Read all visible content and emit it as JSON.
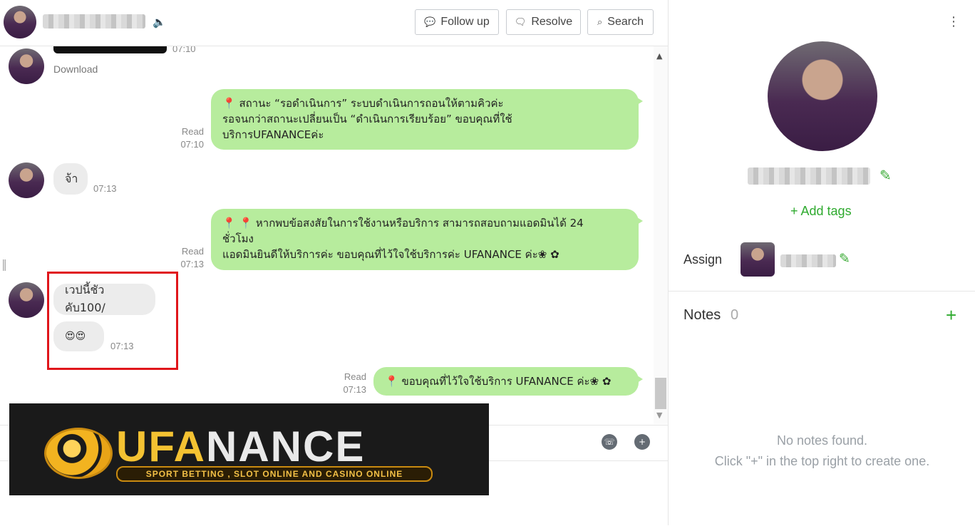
{
  "header": {
    "buttons": [
      {
        "label": "Follow up",
        "icon": "chat-bubble-icon"
      },
      {
        "label": "Resolve",
        "icon": "check-bubble-icon"
      },
      {
        "label": "Search",
        "icon": "search-icon"
      }
    ]
  },
  "chat": {
    "messages": [
      {
        "from": "customer",
        "type": "image",
        "time": "07:10",
        "action": "Download"
      },
      {
        "from": "agent",
        "status": "Read",
        "time": "07:10",
        "lines": [
          "📍 สถานะ “รอดำเนินการ” ระบบดำเนินการถอนให้ตามคิวค่ะ",
          "รอจนกว่าสถานะเปลี่ยนเป็น “ดำเนินการเรียบร้อย” ขอบคุณที่ใช้",
          "บริการUFANANCEค่ะ"
        ]
      },
      {
        "from": "customer",
        "text": "จ้า",
        "time": "07:13"
      },
      {
        "from": "agent",
        "status": "Read",
        "time": "07:13",
        "lines": [
          "📍 📍 หากพบข้อสงสัยในการใช้งานหรือบริการ สามารถสอบถามแอดมินได้ 24",
          "ชั่วโมง",
          "แอดมินยินดีให้บริการค่ะ ขอบคุณที่ไว้ใจใช้บริการค่ะ UFANANCE ค่ะ❀ ✿"
        ]
      },
      {
        "from": "customer",
        "text": "เวปนี้ชัวคับ100/",
        "time": ""
      },
      {
        "from": "customer",
        "text": "😍😍",
        "time": "07:13"
      },
      {
        "from": "agent",
        "status": "Read",
        "time": "07:13",
        "lines": [
          "📍 ขอบคุณที่ไว้ใจใช้บริการ UFANANCE ค่ะ❀ ✿"
        ]
      }
    ]
  },
  "banner": {
    "brand_a": "UFA",
    "brand_b": "NANCE",
    "tagline": "SPORT BETTING , SLOT ONLINE AND CASINO ONLINE"
  },
  "sidebar": {
    "add_tags": "+ Add tags",
    "assign_label": "Assign",
    "notes_title": "Notes",
    "notes_count": "0",
    "notes_add": "+",
    "empty_line1": "No notes found.",
    "empty_line2": "Click \"+\" in the top right to create one."
  },
  "colors": {
    "accent_green": "#2faa2f",
    "outgoing_bubble": "#b7ec9d",
    "incoming_bubble": "#ececec",
    "highlight_red": "#e0161b"
  }
}
